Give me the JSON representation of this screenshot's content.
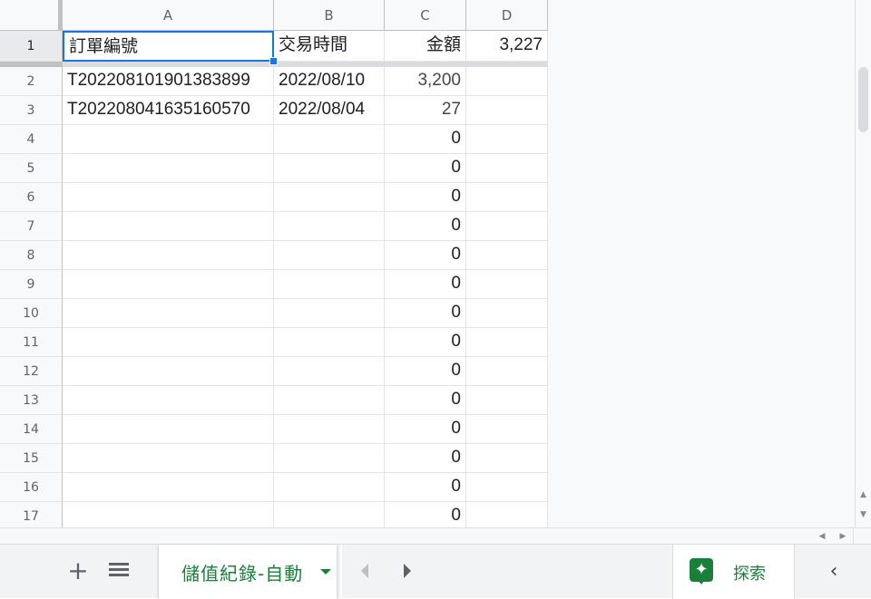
{
  "columns": [
    {
      "label": "A"
    },
    {
      "label": "B"
    },
    {
      "label": "C"
    },
    {
      "label": "D"
    }
  ],
  "header_row": {
    "number": "1",
    "cells": [
      "訂單編號",
      "交易時間",
      "金額",
      "3,227"
    ]
  },
  "rows": [
    {
      "number": "2",
      "cells": [
        "T202208101901383899",
        "2022/08/10",
        "3,200",
        ""
      ]
    },
    {
      "number": "3",
      "cells": [
        "T202208041635160570",
        "2022/08/04",
        "27",
        ""
      ]
    },
    {
      "number": "4",
      "cells": [
        "",
        "",
        "0",
        ""
      ]
    },
    {
      "number": "5",
      "cells": [
        "",
        "",
        "0",
        ""
      ]
    },
    {
      "number": "6",
      "cells": [
        "",
        "",
        "0",
        ""
      ]
    },
    {
      "number": "7",
      "cells": [
        "",
        "",
        "0",
        ""
      ]
    },
    {
      "number": "8",
      "cells": [
        "",
        "",
        "0",
        ""
      ]
    },
    {
      "number": "9",
      "cells": [
        "",
        "",
        "0",
        ""
      ]
    },
    {
      "number": "10",
      "cells": [
        "",
        "",
        "0",
        ""
      ]
    },
    {
      "number": "11",
      "cells": [
        "",
        "",
        "0",
        ""
      ]
    },
    {
      "number": "12",
      "cells": [
        "",
        "",
        "0",
        ""
      ]
    },
    {
      "number": "13",
      "cells": [
        "",
        "",
        "0",
        ""
      ]
    },
    {
      "number": "14",
      "cells": [
        "",
        "",
        "0",
        ""
      ]
    },
    {
      "number": "15",
      "cells": [
        "",
        "",
        "0",
        ""
      ]
    },
    {
      "number": "16",
      "cells": [
        "",
        "",
        "0",
        ""
      ]
    },
    {
      "number": "17",
      "cells": [
        "",
        "",
        "0",
        ""
      ]
    }
  ],
  "selected_cell": "A1",
  "sheetbar": {
    "add_sheet_icon": "plus-icon",
    "all_sheets_icon": "menu-lines-icon",
    "active_sheet": "儲值紀錄-自動",
    "explore_label": "探索",
    "explore_icon": "explore-sparkle-icon",
    "collapse_icon": "chevron-left-icon"
  },
  "colors": {
    "accent_green": "#188038",
    "selection_blue": "#1a73e8",
    "header_bg": "#f8f9fa",
    "grid_line": "#e2e3e3"
  }
}
